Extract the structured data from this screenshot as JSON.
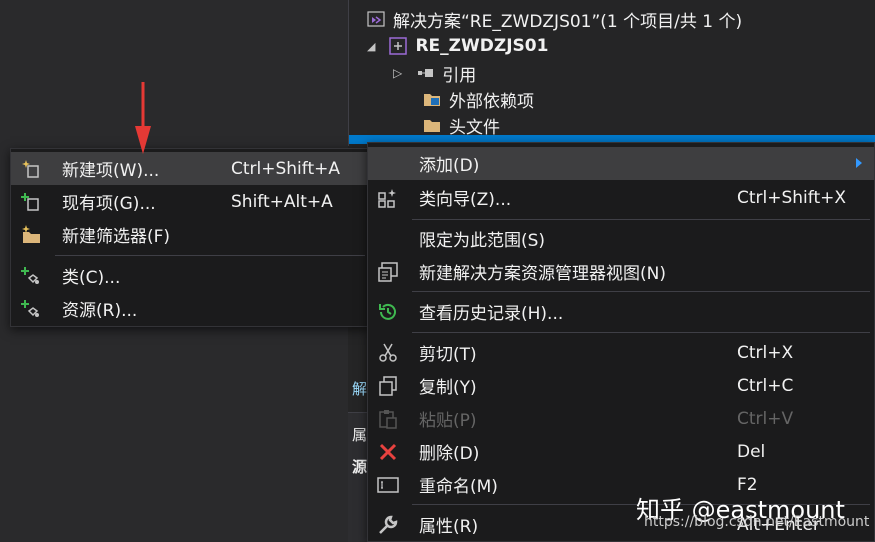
{
  "explorer": {
    "solution_label": "解决方案“RE_ZWDZJS01”(1 个项目/共 1 个)",
    "project_label": "RE_ZWDZJS01",
    "items": [
      {
        "label": "引用",
        "icon": "references-icon"
      },
      {
        "label": "外部依赖项",
        "icon": "folder-external-icon"
      },
      {
        "label": "头文件",
        "icon": "folder-icon"
      }
    ],
    "strip_labels": [
      "解",
      "属",
      "源"
    ]
  },
  "submenu_add": {
    "items": [
      {
        "label": "新建项(W)...",
        "shortcut": "Ctrl+Shift+A",
        "icon": "new-item-icon"
      },
      {
        "label": "现有项(G)...",
        "shortcut": "Shift+Alt+A",
        "icon": "existing-item-icon"
      },
      {
        "label": "新建筛选器(F)",
        "shortcut": "",
        "icon": "new-filter-folder-icon"
      },
      {
        "label": "类(C)...",
        "shortcut": "",
        "icon": "class-icon"
      },
      {
        "label": "资源(R)...",
        "shortcut": "",
        "icon": "resource-icon"
      }
    ]
  },
  "context_menu": {
    "items": [
      {
        "label": "添加(D)",
        "shortcut": "",
        "icon": ""
      },
      {
        "label": "类向导(Z)...",
        "shortcut": "Ctrl+Shift+X",
        "icon": "class-wizard-icon"
      },
      {
        "label": "限定为此范围(S)",
        "shortcut": "",
        "icon": ""
      },
      {
        "label": "新建解决方案资源管理器视图(N)",
        "shortcut": "",
        "icon": "new-view-icon"
      },
      {
        "label": "查看历史记录(H)...",
        "shortcut": "",
        "icon": "history-icon"
      },
      {
        "label": "剪切(T)",
        "shortcut": "Ctrl+X",
        "icon": "scissors-icon"
      },
      {
        "label": "复制(Y)",
        "shortcut": "Ctrl+C",
        "icon": "copy-icon"
      },
      {
        "label": "粘贴(P)",
        "shortcut": "Ctrl+V",
        "icon": "paste-icon"
      },
      {
        "label": "删除(D)",
        "shortcut": "Del",
        "icon": "delete-icon"
      },
      {
        "label": "重命名(M)",
        "shortcut": "F2",
        "icon": "rename-icon"
      },
      {
        "label": "属性(R)",
        "shortcut": "Alt+Enter",
        "icon": "wrench-icon"
      }
    ]
  },
  "watermark": {
    "text": "知乎 @eastmount",
    "url": "https://blog.csdn.net/Eastmount"
  },
  "colors": {
    "accent": "#007acc",
    "submenu_arrow": "#3399ff",
    "annotation_arrow": "#e53935",
    "delete_icon": "#e8423f",
    "history_icon": "#3fb950"
  }
}
